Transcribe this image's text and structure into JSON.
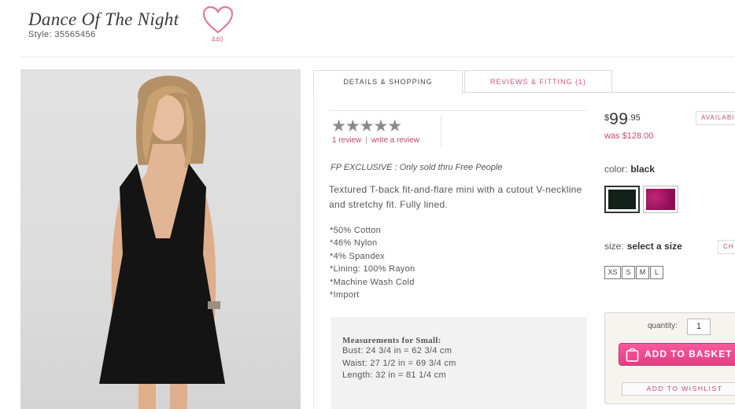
{
  "product": {
    "title": "Dance Of The Night",
    "style_number": "Style: 35565456",
    "favorites_count": "440",
    "heart_icon": "heart-outline-icon"
  },
  "tabs": [
    {
      "label": "DETAILS & SHOPPING",
      "active": true
    },
    {
      "label": "REVIEWS & FITTING (1)",
      "active": false
    }
  ],
  "reviews": {
    "stars": "★★★★★",
    "rating": 5,
    "count_label": "1 review",
    "separator": "|",
    "write_label": "write a review"
  },
  "details": {
    "exclusive": "FP EXCLUSIVE : Only sold thru Free People",
    "description": "Textured T-back fit-and-flare mini with a cutout V-neckline and stretchy fit. Fully lined.",
    "specs": [
      "*50% Cotton",
      "*46% Nylon",
      "*4% Spandex",
      "*Lining: 100% Rayon",
      "*Machine Wash Cold",
      "*Import"
    ],
    "measurements": {
      "title": "Measurements for Small:",
      "lines": [
        "Bust: 24 3/4 in = 62 3/4 cm",
        "Waist: 27 1/2 in = 69 3/4 cm",
        "Length: 32 in = 81 1/4 cm"
      ]
    }
  },
  "pricing": {
    "currency": "$",
    "dollars": "99",
    "cents": ".95",
    "was": "was $128.00",
    "availability": "AVAILABI"
  },
  "color": {
    "label": "color:",
    "selected": "black",
    "swatches": [
      {
        "name": "black",
        "hex": "#14201a"
      },
      {
        "name": "magenta",
        "hex": "#b01f6f"
      }
    ]
  },
  "size": {
    "label": "size:",
    "selected": "select a size",
    "chart_label": "CH",
    "options": [
      "XS",
      "S",
      "M",
      "L"
    ]
  },
  "buy": {
    "quantity_label": "quantity:",
    "quantity_value": "1",
    "add_to_basket": "ADD TO BASKET",
    "add_to_wishlist": "ADD TO WISHLIST",
    "accent": "#e63c84"
  }
}
